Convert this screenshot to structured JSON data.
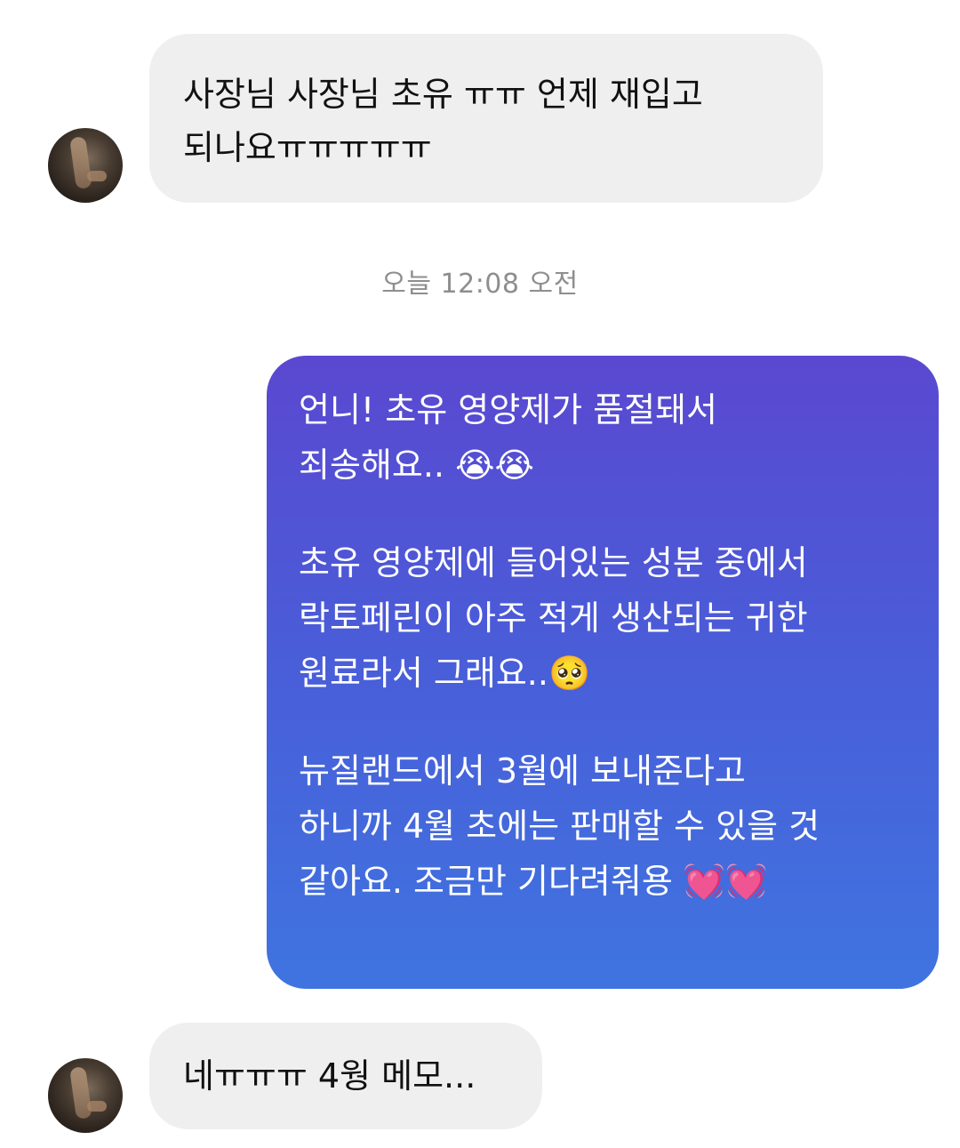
{
  "messages": [
    {
      "sender": "other",
      "lines": [
        "사장님 사장님 초유 ㅠㅠ 언제 재입고",
        "되나요ㅠㅠㅠㅠㅠ"
      ]
    },
    {
      "sender": "me",
      "paragraphs": [
        [
          "언니! 초유 영양제가 품절돼서",
          "죄송해요.. 😭😭"
        ],
        [
          "초유 영양제에 들어있는 성분 중에서",
          "락토페린이 아주 적게 생산되는 귀한",
          "원료라서 그래요..🥺"
        ],
        [
          "뉴질랜드에서 3월에 보내준다고",
          "하니까 4월 초에는 판매할 수 있을 것",
          "같아요. 조금만 기다려줘용 💓💓"
        ]
      ]
    },
    {
      "sender": "other",
      "lines": [
        "네ㅠㅠㅠ 4웡 메모..."
      ]
    }
  ],
  "timestamp": "오늘 12:08 오전"
}
